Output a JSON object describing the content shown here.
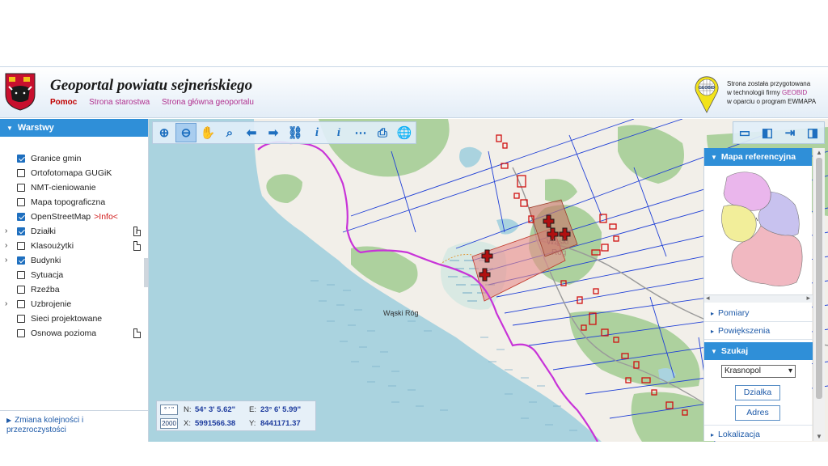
{
  "header": {
    "title": "Geoportal powiatu sejneńskiego",
    "nav": [
      "Pomoc",
      "Strona starostwa",
      "Strona główna geoportalu"
    ],
    "geobid_logo_text": "GEOBID",
    "geobid_line1": "Strona została przygotowana",
    "geobid_line2_pre": "w technologii firmy ",
    "geobid_line2_brand": "GEOBID",
    "geobid_line3": "w oparciu o program EWMAPA"
  },
  "layers_panel": {
    "title": "Warstwy",
    "items": [
      {
        "label": "Granice gmin",
        "checked": true
      },
      {
        "label": "Ortofotomapa GUGiK",
        "checked": false
      },
      {
        "label": "NMT-cieniowanie",
        "checked": false
      },
      {
        "label": "Mapa topograficzna",
        "checked": false
      },
      {
        "label": "OpenStreetMap",
        "checked": true,
        "extra": ">Info<"
      },
      {
        "label": "Działki",
        "checked": true,
        "expander": true,
        "doc": "info"
      },
      {
        "label": "Klasoużytki",
        "checked": false,
        "expander": true,
        "doc": "doc"
      },
      {
        "label": "Budynki",
        "checked": true,
        "expander": true
      },
      {
        "label": "Sytuacja",
        "checked": false
      },
      {
        "label": "Rzeźba",
        "checked": false
      },
      {
        "label": "Uzbrojenie",
        "checked": false,
        "expander": true
      },
      {
        "label": "Sieci projektowane",
        "checked": false
      },
      {
        "label": "Osnowa pozioma",
        "checked": false,
        "doc": "doc"
      }
    ],
    "order_link": "Zmiana kolejności i przezroczystości"
  },
  "toolbar": {
    "tools": [
      "zoom-in-icon",
      "zoom-out-icon",
      "pan-hand-icon",
      "zoom-region-icon",
      "back-arrow-icon",
      "forward-arrow-icon",
      "link-icon",
      "info-icon",
      "query-info-icon",
      "measure-icon",
      "print-icon",
      "globe-icon"
    ],
    "view_tools": [
      "layout-full-icon",
      "layout-left-panel-icon",
      "layout-arrow-icon",
      "layout-right-panel-icon"
    ]
  },
  "coords": {
    "dms_button": "° ' \"",
    "crs_button": "2000",
    "n_label": "N:",
    "n_value": "54° 3' 5.62\"",
    "e_label": "E:",
    "e_value": "23° 6' 5.99\"",
    "x_label": "X:",
    "x_value": "5991566.38",
    "y_label": "Y:",
    "y_value": "8441171.37"
  },
  "map": {
    "place_label": "Wąski Róg",
    "place_label_2_line1": "Wąski",
    "place_label_2_line2": "Róg",
    "colors": {
      "water": "#aad3df",
      "land": "#f2efe9",
      "forest": "#add19e",
      "boundary": "#c833d8",
      "parcel": "#1f3fd6",
      "building": "#d01010"
    }
  },
  "right_panel": {
    "refmap_title": "Mapa referencyjna",
    "pomiary": "Pomiary",
    "powiekszenia": "Powiększenia",
    "search_title": "Szukaj",
    "select_value": "Krasnopol",
    "btn_dzialka": "Działka",
    "btn_adres": "Adres",
    "lokalizacja": "Lokalizacja"
  }
}
